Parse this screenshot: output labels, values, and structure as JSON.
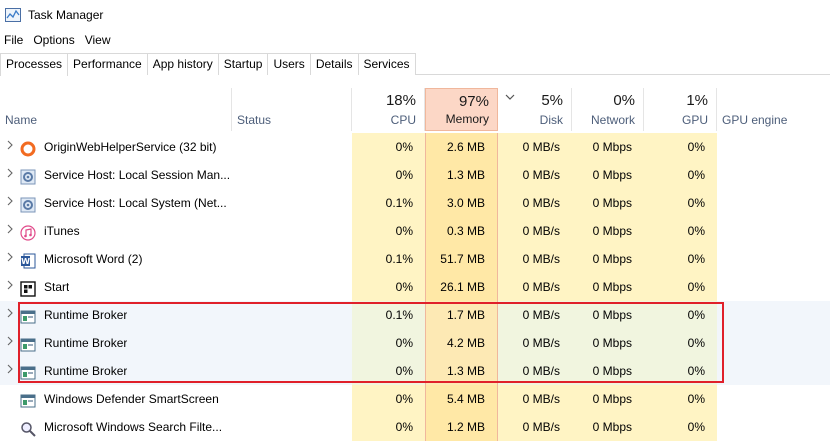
{
  "window": {
    "title": "Task Manager"
  },
  "menu": [
    "File",
    "Options",
    "View"
  ],
  "tabs": [
    "Processes",
    "Performance",
    "App history",
    "Startup",
    "Users",
    "Details",
    "Services"
  ],
  "header": {
    "name": "Name",
    "status": "Status",
    "cpu": {
      "pct": "18%",
      "label": "CPU"
    },
    "memory": {
      "pct": "97%",
      "label": "Memory"
    },
    "disk": {
      "pct": "5%",
      "label": "Disk"
    },
    "network": {
      "pct": "0%",
      "label": "Network"
    },
    "gpu": {
      "pct": "1%",
      "label": "GPU"
    },
    "gpu_engine": "GPU engine",
    "sort_indicator": "chevron-down-icon"
  },
  "processes": [
    {
      "name": "OriginWebHelperService (32 bit)",
      "icon": "origin-icon",
      "expandable": true,
      "cpu": "0%",
      "memory": "2.6 MB",
      "disk": "0 MB/s",
      "network": "0 Mbps",
      "gpu": "0%"
    },
    {
      "name": "Service Host: Local Session Man...",
      "icon": "service-gear-icon",
      "expandable": true,
      "cpu": "0%",
      "memory": "1.3 MB",
      "disk": "0 MB/s",
      "network": "0 Mbps",
      "gpu": "0%"
    },
    {
      "name": "Service Host: Local System (Net...",
      "icon": "service-gear-icon",
      "expandable": true,
      "cpu": "0.1%",
      "memory": "3.0 MB",
      "disk": "0 MB/s",
      "network": "0 Mbps",
      "gpu": "0%"
    },
    {
      "name": "iTunes",
      "icon": "itunes-icon",
      "expandable": true,
      "cpu": "0%",
      "memory": "0.3 MB",
      "disk": "0 MB/s",
      "network": "0 Mbps",
      "gpu": "0%"
    },
    {
      "name": "Microsoft Word (2)",
      "icon": "word-icon",
      "expandable": true,
      "cpu": "0.1%",
      "memory": "51.7 MB",
      "disk": "0 MB/s",
      "network": "0 Mbps",
      "gpu": "0%"
    },
    {
      "name": "Start",
      "icon": "start-icon",
      "expandable": true,
      "cpu": "0%",
      "memory": "26.1 MB",
      "disk": "0 MB/s",
      "network": "0 Mbps",
      "gpu": "0%"
    },
    {
      "name": "Runtime Broker",
      "icon": "runtime-broker-icon",
      "expandable": true,
      "cpu": "0.1%",
      "memory": "1.7 MB",
      "disk": "0 MB/s",
      "network": "0 Mbps",
      "gpu": "0%"
    },
    {
      "name": "Runtime Broker",
      "icon": "runtime-broker-icon",
      "expandable": true,
      "cpu": "0%",
      "memory": "4.2 MB",
      "disk": "0 MB/s",
      "network": "0 Mbps",
      "gpu": "0%"
    },
    {
      "name": "Runtime Broker",
      "icon": "runtime-broker-icon",
      "expandable": true,
      "cpu": "0%",
      "memory": "1.3 MB",
      "disk": "0 MB/s",
      "network": "0 Mbps",
      "gpu": "0%"
    },
    {
      "name": "Windows Defender SmartScreen",
      "icon": "runtime-broker-icon",
      "expandable": false,
      "cpu": "0%",
      "memory": "5.4 MB",
      "disk": "0 MB/s",
      "network": "0 Mbps",
      "gpu": "0%"
    },
    {
      "name": "Microsoft Windows Search Filte...",
      "icon": "search-filter-icon",
      "expandable": false,
      "cpu": "0%",
      "memory": "1.2 MB",
      "disk": "0 MB/s",
      "network": "0 Mbps",
      "gpu": "0%"
    }
  ],
  "colors": {
    "highlight_border": "#e0202a",
    "memory_header": "#fcd7c6",
    "heat_cell": "#fff4c4"
  }
}
